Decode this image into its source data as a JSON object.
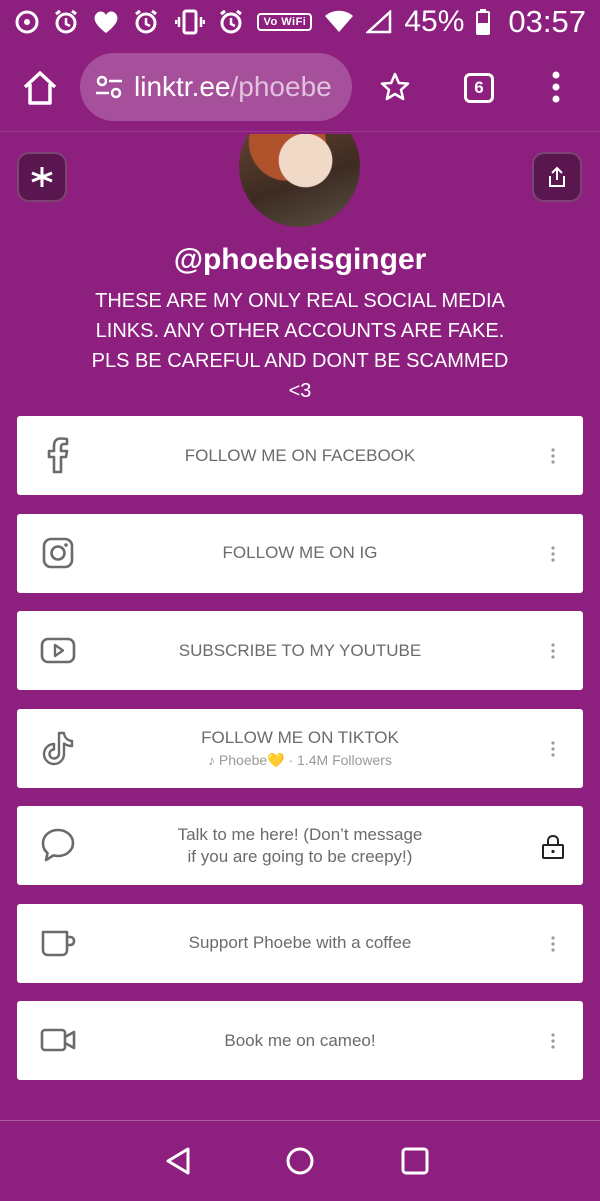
{
  "status_bar": {
    "vowifi": "Vo WiFi",
    "battery": "45%",
    "time": "03:57"
  },
  "browser": {
    "url_domain": "linktr.ee",
    "url_path": "/phoebe",
    "tab_count": "6"
  },
  "profile": {
    "username": "@phoebeisginger",
    "bio": "THESE ARE MY ONLY REAL SOCIAL MEDIA LINKS. ANY OTHER ACCOUNTS ARE FAKE. PLS BE CAREFUL AND DONT BE SCAMMED <3"
  },
  "links": [
    {
      "title": "FOLLOW ME ON FACEBOOK",
      "icon": "facebook-icon"
    },
    {
      "title": "FOLLOW ME ON IG",
      "icon": "instagram-icon"
    },
    {
      "title": "SUBSCRIBE TO MY YOUTUBE",
      "icon": "youtube-icon"
    },
    {
      "title": "FOLLOW ME ON TIKTOK",
      "icon": "tiktok-icon",
      "subtitle_name": "Phoebe💛",
      "subtitle_followers": "· 1.4M Followers"
    },
    {
      "title": "Talk to me here! (Don’t message",
      "title_line2": "if you are going to be creepy!)",
      "icon": "chat-bubble-icon",
      "locked": true
    },
    {
      "title": "Support Phoebe with a coffee",
      "icon": "coffee-cup-icon"
    },
    {
      "title": "Book me on cameo!",
      "icon": "video-camera-icon"
    }
  ],
  "colors": {
    "background": "#8d1f7f",
    "card": "#ffffff",
    "card_text": "#6b6b6b"
  }
}
